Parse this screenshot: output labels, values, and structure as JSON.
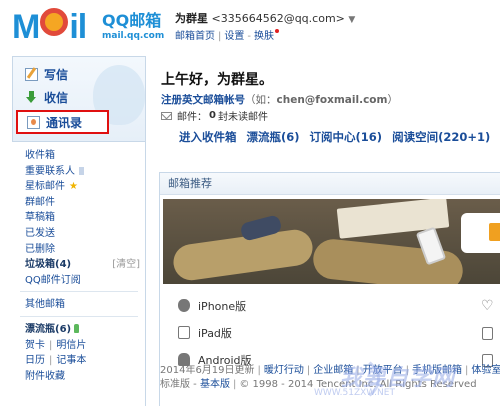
{
  "logo": {
    "letter_m": "M",
    "letters_il": "il",
    "cn_name": "QQ邮箱",
    "domain": "mail.qq.com"
  },
  "user": {
    "name": "为群星",
    "email": "<335664562@qq.com>",
    "links": [
      "邮箱首页",
      "设置",
      "换肤"
    ]
  },
  "sidebar": {
    "actions": [
      {
        "label": "写信",
        "icon": "pencil-paper-icon"
      },
      {
        "label": "收信",
        "icon": "download-arrow-icon"
      },
      {
        "label": "通讯录",
        "icon": "contact-card-icon"
      }
    ],
    "folders": [
      {
        "label": "收件箱"
      },
      {
        "label": "重要联系人"
      },
      {
        "label": "星标邮件"
      },
      {
        "label": "群邮件"
      },
      {
        "label": "草稿箱"
      },
      {
        "label": "已发送"
      },
      {
        "label": "已删除"
      },
      {
        "label": "垃圾箱(4)",
        "clear": "[清空]"
      },
      {
        "label": "QQ邮件订阅"
      }
    ],
    "others": "其他邮箱",
    "bottle": "漂流瓶(6)",
    "apps_row1": [
      "贺卡",
      "明信片"
    ],
    "apps_row2": [
      "日历",
      "记事本"
    ],
    "apps_row3": "附件收藏"
  },
  "main": {
    "greeting_prefix": "上午好，",
    "greeting_name": "为群星",
    "greeting_suffix": "。",
    "register_link": "注册英文邮箱帐号",
    "register_hint_prefix": "（如：",
    "register_hint_mail": "chen@foxmail.com",
    "register_hint_suffix": "）",
    "unread_prefix": "邮件：",
    "unread_count": "0",
    "unread_suffix": "封未读邮件",
    "quicklinks": [
      "进入收件箱",
      "漂流瓶(6)",
      "订阅中心(16)",
      "阅读空间(220+1)"
    ],
    "recommend_title": "邮箱推荐",
    "platforms": [
      "iPhone版",
      "iPad版",
      "Android版"
    ]
  },
  "footer": {
    "row1": [
      "2014年6月19日更新",
      "暖灯行动",
      "企业邮箱",
      "开放平台",
      "手机版邮箱",
      "体验室"
    ],
    "row2_prefix": "标准版 -",
    "row2_link": "基本版",
    "row2_copyright": "© 1998 - 2014 Tencent Inc. All Rights Reserved"
  },
  "watermark": {
    "text": "我要自学网",
    "sub": "WWW.51ZXW.NET"
  }
}
